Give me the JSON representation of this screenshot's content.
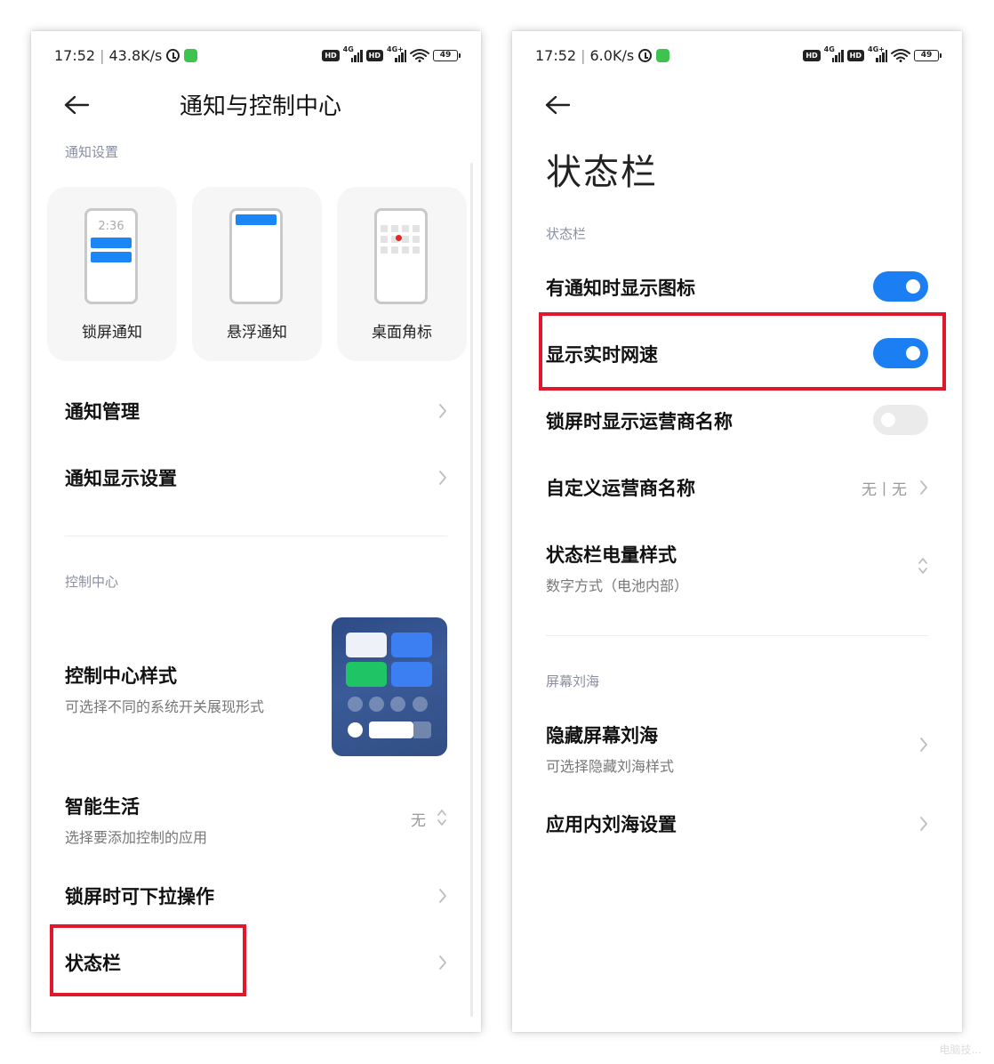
{
  "left": {
    "status": {
      "time": "17:52",
      "speed": "43.8K/s",
      "battery": "49",
      "net1": "4G",
      "net2": "4G+"
    },
    "title": "通知与控制中心",
    "section_notify": "通知设置",
    "cards": [
      {
        "label": "锁屏通知",
        "time": "2:36"
      },
      {
        "label": "悬浮通知"
      },
      {
        "label": "桌面角标"
      }
    ],
    "rows": {
      "notify_manage": "通知管理",
      "notify_display": "通知显示设置",
      "cc_style_title": "控制中心样式",
      "cc_style_sub": "可选择不同的系统开关展现形式",
      "smart_title": "智能生活",
      "smart_sub": "选择要添加控制的应用",
      "smart_value": "无",
      "lock_pull": "锁屏时可下拉操作",
      "status_bar": "状态栏"
    },
    "section_control": "控制中心"
  },
  "right": {
    "status": {
      "time": "17:52",
      "speed": "6.0K/s",
      "battery": "49",
      "net1": "4G",
      "net2": "4G+"
    },
    "title": "状态栏",
    "section_status": "状态栏",
    "rows": {
      "notif_icons": "有通知时显示图标",
      "net_speed": "显示实时网速",
      "lock_carrier": "锁屏时显示运营商名称",
      "custom_carrier": "自定义运营商名称",
      "custom_carrier_value": "无丨无",
      "battery_style_title": "状态栏电量样式",
      "battery_style_sub": "数字方式（电池内部）",
      "hide_notch_title": "隐藏屏幕刘海",
      "hide_notch_sub": "可选择隐藏刘海样式",
      "inapp_notch": "应用内刘海设置"
    },
    "section_notch": "屏幕刘海",
    "toggles": {
      "notif_icons": true,
      "net_speed": true,
      "lock_carrier": false
    }
  },
  "colors": {
    "accent": "#1b7ff3",
    "highlight": "#e1182b",
    "cc_green": "#1fc465",
    "cc_blue": "#3c7ff2"
  },
  "watermark": "电脑技..."
}
